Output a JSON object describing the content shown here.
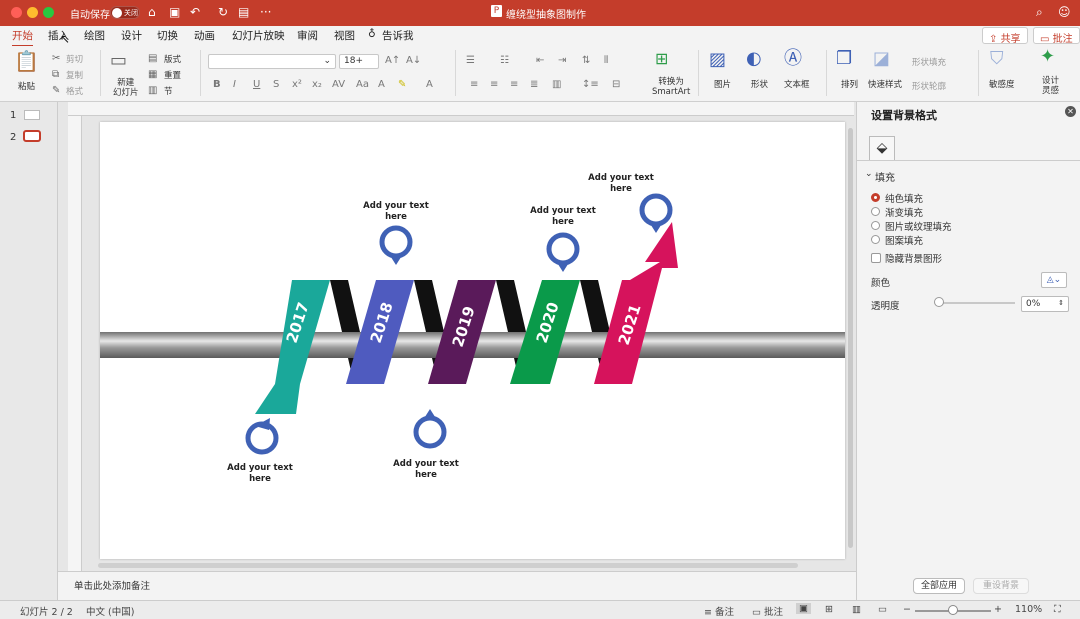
{
  "titlebar": {
    "autosave_label": "自动保存",
    "autosave_toggle": "关闭",
    "doc_title": "缠绕型抽象图制作"
  },
  "tabs": [
    "开始",
    "插入",
    "绘图",
    "设计",
    "切换",
    "动画",
    "幻灯片放映",
    "审阅",
    "视图",
    "告诉我"
  ],
  "share_button": "共享",
  "comments_button": "批注",
  "ribbon": {
    "paste": "粘贴",
    "cut": "剪切",
    "copy": "复制",
    "format": "格式",
    "new_slide": "新建\n幻灯片",
    "layout": "版式",
    "reset": "重置",
    "section": "节",
    "font_size": "18+",
    "convert_smartart": "转换为\nSmartArt",
    "picture": "图片",
    "shape": "形状",
    "textbox": "文本框",
    "arrange": "排列",
    "quick_styles": "快速样式",
    "shape_fill": "形状填充",
    "shape_outline": "形状轮廓",
    "sensitivity": "敏感度",
    "designer": "设计\n灵感"
  },
  "thumbnails": [
    "1",
    "2"
  ],
  "slide": {
    "years": [
      "2017",
      "2018",
      "2019",
      "2020",
      "2021"
    ],
    "labels": [
      "Add your text\nhere",
      "Add your text\nhere",
      "Add your text\nhere",
      "Add your text\nhere",
      "Add your text\nhere"
    ]
  },
  "notes_placeholder": "单击此处添加备注",
  "pane": {
    "title": "设置背景格式",
    "section": "填充",
    "options": [
      "纯色填充",
      "渐变填充",
      "图片或纹理填充",
      "图案填充"
    ],
    "selected_option": "纯色填充",
    "hide_bg": "隐藏背景图形",
    "color_label": "颜色",
    "transparency_label": "透明度",
    "transparency_value": "0%",
    "apply_all": "全部应用",
    "reset_bg": "重设背景"
  },
  "status": {
    "slide_count": "幻灯片 2 / 2",
    "language": "中文 (中国)",
    "notes": "备注",
    "comments": "批注",
    "zoom": "110%"
  },
  "colors": {
    "titlebar": "#c43d2b",
    "ribbon_2017": "#1aa89a",
    "ribbon_2018": "#4f5bbf",
    "ribbon_2019": "#5a1a5a",
    "ribbon_2020": "#0a9a4a",
    "ribbon_2021": "#d6135c",
    "pin": "#3f61b5"
  }
}
